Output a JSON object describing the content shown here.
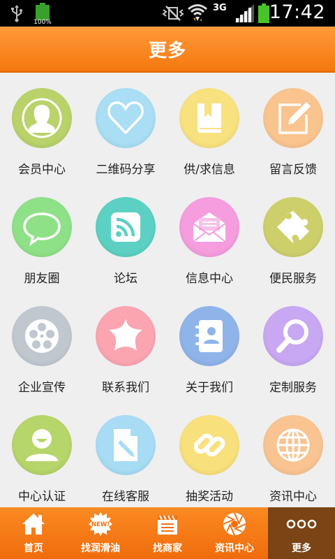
{
  "status_bar": {
    "battery_small_label": "100%",
    "network_type": "3G",
    "time": "17:42"
  },
  "header": {
    "title": "更多"
  },
  "grid": {
    "items": [
      {
        "label": "会员中心",
        "icon": "member-avatar-icon",
        "color": "#b9d26a"
      },
      {
        "label": "二维码分享",
        "icon": "heart-icon",
        "color": "#a9def4"
      },
      {
        "label": "供/求信息",
        "icon": "book-bookmark-icon",
        "color": "#f8e17f"
      },
      {
        "label": "留言反馈",
        "icon": "edit-pencil-icon",
        "color": "#f9c48e"
      },
      {
        "label": "朋友圈",
        "icon": "chat-bubble-icon",
        "color": "#8fe187"
      },
      {
        "label": "论坛",
        "icon": "rss-feed-icon",
        "color": "#5cd1c3"
      },
      {
        "label": "信息中心",
        "icon": "mail-envelope-icon",
        "color": "#f59dde"
      },
      {
        "label": "便民服务",
        "icon": "puzzle-piece-icon",
        "color": "#cdd06a"
      },
      {
        "label": "企业宣传",
        "icon": "film-reel-icon",
        "color": "#c1c7cf"
      },
      {
        "label": "联系我们",
        "icon": "star-icon",
        "color": "#fba5b1"
      },
      {
        "label": "关于我们",
        "icon": "contact-book-icon",
        "color": "#8fb4ea"
      },
      {
        "label": "定制服务",
        "icon": "magnifier-icon",
        "color": "#c8a7f3"
      },
      {
        "label": "中心认证",
        "icon": "user-smile-icon",
        "color": "#b6d56a"
      },
      {
        "label": "在线客服",
        "icon": "document-pen-icon",
        "color": "#a7dcf4"
      },
      {
        "label": "抽奖活动",
        "icon": "chain-link-icon",
        "color": "#f8e07c"
      },
      {
        "label": "资讯中心",
        "icon": "globe-icon",
        "color": "#f9c491"
      }
    ]
  },
  "bottom_nav": {
    "tabs": [
      {
        "label": "首页",
        "icon": "home-icon",
        "active": false
      },
      {
        "label": "找润滑油",
        "icon": "new-badge-icon",
        "active": false
      },
      {
        "label": "找商家",
        "icon": "clapperboard-icon",
        "active": false
      },
      {
        "label": "资讯中心",
        "icon": "aperture-icon",
        "active": false
      },
      {
        "label": "更多",
        "icon": "more-dots-icon",
        "active": true
      }
    ],
    "new_badge_text": "NEW!"
  }
}
